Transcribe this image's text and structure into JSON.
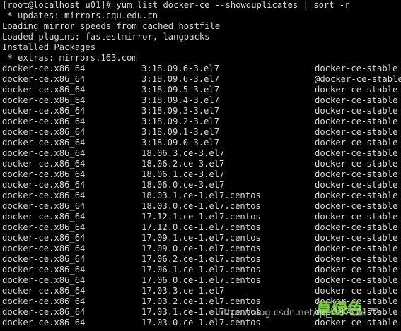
{
  "terminal": {
    "prompt": "[root@localhost u01]# yum list docker-ce --showduplicates | sort -r",
    "header_lines": [
      " * updates: mirrors.cqu.edu.cn",
      "Loading mirror speeds from cached hostfile",
      "Loaded plugins: fastestmirror, langpacks",
      "Installed Packages",
      " * extras: mirrors.163.com"
    ],
    "packages": [
      {
        "name": "docker-ce.x86_64",
        "version": "3:18.09.6-3.el7",
        "repo": "docker-ce-stable"
      },
      {
        "name": "docker-ce.x86_64",
        "version": "3:18.09.6-3.el7",
        "repo": "@docker-ce-stable"
      },
      {
        "name": "docker-ce.x86_64",
        "version": "3:18.09.5-3.el7",
        "repo": "docker-ce-stable"
      },
      {
        "name": "docker-ce.x86_64",
        "version": "3:18.09.4-3.el7",
        "repo": "docker-ce-stable"
      },
      {
        "name": "docker-ce.x86_64",
        "version": "3:18.09.3-3.el7",
        "repo": "docker-ce-stable"
      },
      {
        "name": "docker-ce.x86_64",
        "version": "3:18.09.2-3.el7",
        "repo": "docker-ce-stable"
      },
      {
        "name": "docker-ce.x86_64",
        "version": "3:18.09.1-3.el7",
        "repo": "docker-ce-stable"
      },
      {
        "name": "docker-ce.x86_64",
        "version": "3:18.09.0-3.el7",
        "repo": "docker-ce-stable"
      },
      {
        "name": "docker-ce.x86_64",
        "version": "18.06.3.ce-3.el7",
        "repo": "docker-ce-stable"
      },
      {
        "name": "docker-ce.x86_64",
        "version": "18.06.2.ce-3.el7",
        "repo": "docker-ce-stable"
      },
      {
        "name": "docker-ce.x86_64",
        "version": "18.06.1.ce-3.el7",
        "repo": "docker-ce-stable"
      },
      {
        "name": "docker-ce.x86_64",
        "version": "18.06.0.ce-3.el7",
        "repo": "docker-ce-stable"
      },
      {
        "name": "docker-ce.x86_64",
        "version": "18.03.1.ce-1.el7.centos",
        "repo": "docker-ce-stable"
      },
      {
        "name": "docker-ce.x86_64",
        "version": "18.03.0.ce-1.el7.centos",
        "repo": "docker-ce-stable"
      },
      {
        "name": "docker-ce.x86_64",
        "version": "17.12.1.ce-1.el7.centos",
        "repo": "docker-ce-stable"
      },
      {
        "name": "docker-ce.x86_64",
        "version": "17.12.0.ce-1.el7.centos",
        "repo": "docker-ce-stable"
      },
      {
        "name": "docker-ce.x86_64",
        "version": "17.09.1.ce-1.el7.centos",
        "repo": "docker-ce-stable"
      },
      {
        "name": "docker-ce.x86_64",
        "version": "17.09.0.ce-1.el7.centos",
        "repo": "docker-ce-stable"
      },
      {
        "name": "docker-ce.x86_64",
        "version": "17.06.2.ce-1.el7.centos",
        "repo": "docker-ce-stable"
      },
      {
        "name": "docker-ce.x86_64",
        "version": "17.06.1.ce-1.el7.centos",
        "repo": "docker-ce-stable"
      },
      {
        "name": "docker-ce.x86_64",
        "version": "17.06.0.ce-1.el7.centos",
        "repo": "docker-ce-stable"
      },
      {
        "name": "docker-ce.x86_64",
        "version": "17.03.3.ce-1.el7",
        "repo": "docker-ce-stable"
      },
      {
        "name": "docker-ce.x86_64",
        "version": "17.03.2.ce-1.el7.centos",
        "repo": "docker-ce-stable"
      },
      {
        "name": "docker-ce.x86_64",
        "version": "17.03.1.ce-1.el7.centos",
        "repo": "docker-ce-stable"
      },
      {
        "name": "docker-ce.x86_64",
        "version": "17.03.0.ce-1.el7.centos",
        "repo": "docker-ce-stable"
      }
    ]
  },
  "watermark": {
    "url": "https://blog.csdn.net/qq_33722172",
    "logo": "草绿色"
  },
  "colors": {
    "background": "#000000",
    "text": "#d8d8d8",
    "logo": "#7ccf3f"
  }
}
